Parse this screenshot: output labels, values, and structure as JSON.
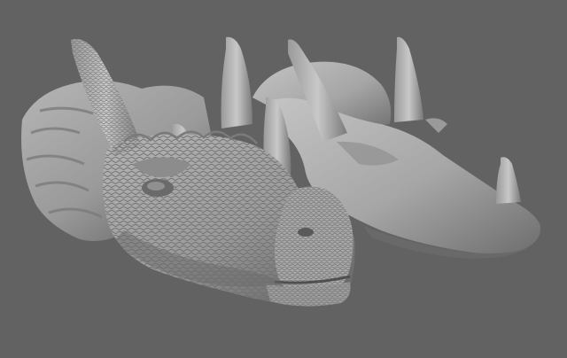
{
  "viewport": {
    "background_color": "#626262",
    "model_color_light": "#b8b8b8",
    "model_color_mid": "#8f8f8f",
    "model_color_dark": "#5c5c5c"
  },
  "models": [
    {
      "name": "dragon-head-high-detail"
    },
    {
      "name": "dragon-head-low-poly-base"
    }
  ]
}
